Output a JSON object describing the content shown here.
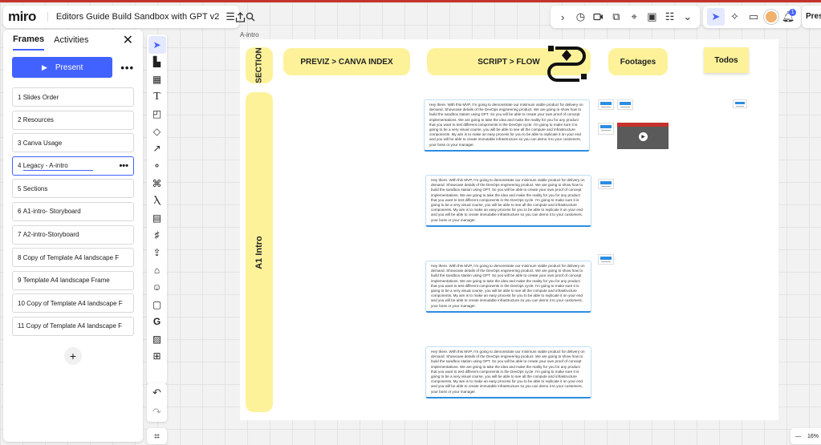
{
  "app": {
    "logo": "miro",
    "board_title": "Editors Guide Build Sandbox with GPT v2",
    "present_label": "Present"
  },
  "panel": {
    "tabs": [
      "Frames",
      "Activities"
    ],
    "close": "✕",
    "present_button": "Present",
    "more": "•••",
    "frames": [
      {
        "num": "1",
        "name": "Slides Order"
      },
      {
        "num": "2",
        "name": "Resources"
      },
      {
        "num": "3",
        "name": "Canva Usage"
      },
      {
        "num": "4",
        "name": "Legacy - A-intro"
      },
      {
        "num": "5",
        "name": "Sections"
      },
      {
        "num": "6",
        "name": "A1-intro- Storyboard"
      },
      {
        "num": "7",
        "name": "A2-intro-Storyboard"
      },
      {
        "num": "8",
        "name": "Copy of Template A4 landscape F"
      },
      {
        "num": "9",
        "name": "Template A4 landscape Frame"
      },
      {
        "num": "10",
        "name": "Copy of Template A4 landscape F"
      },
      {
        "num": "11",
        "name": "Copy of Template A4 landscape F"
      }
    ],
    "add": "+"
  },
  "canvas": {
    "frame_label": "A-intro",
    "section_label": "SECTION",
    "row_label": "A1 Intro",
    "headers": [
      "PREVIZ > CANVA INDEX",
      "SCRIPT > FLOW",
      "Footages"
    ],
    "sticky": "Todos",
    "script_text": "Hey there. With this MVP, I'm going to demonstrate our minimum viable product for delivery on demand. Showcase details of the DevOps engineering product. We are going to show how to build the sandbox station using GPT. So you will be able to create your own proof of concept implementations. We are going to take the idea and make the reality for you for any product that you want to test different components in the DevOps cycle. I'm going to make sure it is going to be a very visual course, you will be able to see all the compute and infrastructure components. My aim is to make an easy process for you to be able to replicate it on your end and you will be able to create immutable infrastructure so you can demo it to your customers, your boss or your manager."
  },
  "zoom": {
    "minus": "—",
    "level": "16%"
  },
  "notifications": "1",
  "colors": {
    "accent": "#4262ff",
    "sticky": "#fdf29a",
    "card_border": "#2b8de3",
    "brand_red": "#c4332e"
  }
}
